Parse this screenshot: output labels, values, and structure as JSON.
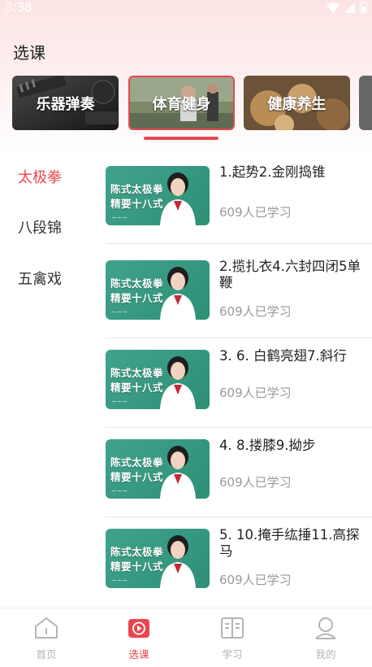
{
  "status_bar": {
    "time": "3:38"
  },
  "page": {
    "title": "选课"
  },
  "categories": [
    {
      "label": "乐器弹奏",
      "selected": false
    },
    {
      "label": "体育健身",
      "selected": true
    },
    {
      "label": "健康养生",
      "selected": false
    }
  ],
  "left_nav": [
    {
      "label": "太极拳",
      "active": true
    },
    {
      "label": "八段锦",
      "active": false
    },
    {
      "label": "五禽戏",
      "active": false
    }
  ],
  "thumbnail": {
    "line1": "陈式太极拳",
    "line2": "精要十八式"
  },
  "courses": [
    {
      "title": "1.起势2.金刚捣锥",
      "learners": "609人已学习"
    },
    {
      "title": "2.揽扎衣4.六封四闭5单鞭",
      "learners": "609人已学习"
    },
    {
      "title": "3. 6. 白鹤亮翅7.斜行",
      "learners": "609人已学习"
    },
    {
      "title": "4. 8.搂膝9.拗步",
      "learners": "609人已学习"
    },
    {
      "title": "5. 10.掩手纮捶11.高探马",
      "learners": "609人已学习"
    }
  ],
  "tabbar": [
    {
      "label": "首页",
      "icon": "home-icon",
      "active": false
    },
    {
      "label": "选课",
      "icon": "play-video-icon",
      "active": true
    },
    {
      "label": "学习",
      "icon": "book-icon",
      "active": false
    },
    {
      "label": "我的",
      "icon": "profile-icon",
      "active": false
    }
  ],
  "colors": {
    "accent": "#e8464f",
    "thumb_green": "#3fa38a",
    "muted": "#999999"
  }
}
